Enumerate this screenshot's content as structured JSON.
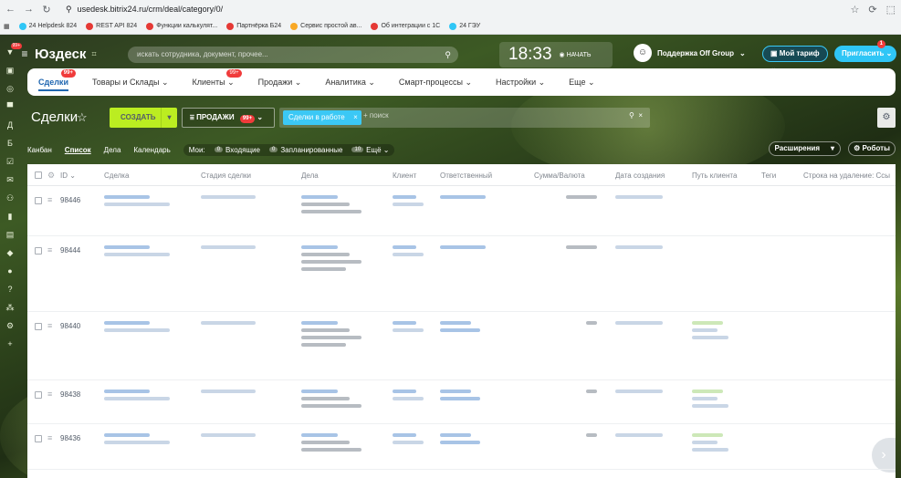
{
  "browser": {
    "url": "usedesk.bitrix24.ru/crm/deal/category/0/",
    "bookmarks": [
      {
        "label": "24 Helpdesk 824",
        "color": "#2fc6f6"
      },
      {
        "label": "REST API 824",
        "color": "#e53935"
      },
      {
        "label": "Функции калькулят...",
        "color": "#e53935"
      },
      {
        "label": "Партнёрка Б24",
        "color": "#e53935"
      },
      {
        "label": "Сервис простой ав...",
        "color": "#f9a825"
      },
      {
        "label": "Об интеграции с 1С",
        "color": "#e53935"
      },
      {
        "label": "24 ГЭУ",
        "color": "#2fc6f6"
      }
    ]
  },
  "header": {
    "logo": "Юздеск",
    "search_placeholder": "искать сотрудника, документ, прочее...",
    "clock": "18:33",
    "start_label": "◉ НАЧАТЬ",
    "support": "Поддержка Off Group",
    "tariff": "Мой тариф",
    "invite": "Пригласить",
    "invite_badge": "1",
    "left_badge": "99+"
  },
  "menu": {
    "items": [
      {
        "label": "Сделки",
        "badge": "99+",
        "active": true
      },
      {
        "label": "Товары и Склады ⌄",
        "badge": ""
      },
      {
        "label": "Клиенты ⌄",
        "badge": "99+"
      },
      {
        "label": "Продажи ⌄",
        "badge": ""
      },
      {
        "label": "Аналитика ⌄",
        "badge": ""
      },
      {
        "label": "Смарт-процессы ⌄",
        "badge": ""
      },
      {
        "label": "Настройки ⌄",
        "badge": ""
      },
      {
        "label": "Еще ⌄",
        "badge": ""
      }
    ]
  },
  "deals": {
    "title": "Сделки",
    "create": "СОЗДАТЬ",
    "filter_label": "ПРОДАЖИ",
    "filter_badge": "99+",
    "chip": "Сделки в работе",
    "search_placeholder": "+ поиск"
  },
  "views": {
    "tabs": [
      "Канбан",
      "Список",
      "Дела",
      "Календарь"
    ],
    "my": "Мои:",
    "incoming": "Входящие",
    "incoming_count": "0",
    "planned": "Запланированные",
    "planned_count": "0",
    "more_count": "10",
    "more": "Ещё ⌄",
    "extensions": "Расширения",
    "robots": "Роботы"
  },
  "table": {
    "headers": [
      "ID ⌄",
      "Сделка",
      "Стадия сделки",
      "Дела",
      "Клиент",
      "Ответственный",
      "Сумма/Валюта",
      "Дата создания",
      "Путь клиента",
      "Теги",
      "Строка на удаление: Ссы"
    ],
    "rows": [
      {
        "id": "98446",
        "stage": "#f06d94"
      },
      {
        "id": "98444",
        "stage": "#f06d94"
      },
      {
        "id": "98440",
        "stage": "#3bc8f5"
      },
      {
        "id": "98438",
        "stage": "#3bc8f5"
      },
      {
        "id": "98436",
        "stage": "#dde1e5"
      }
    ]
  }
}
